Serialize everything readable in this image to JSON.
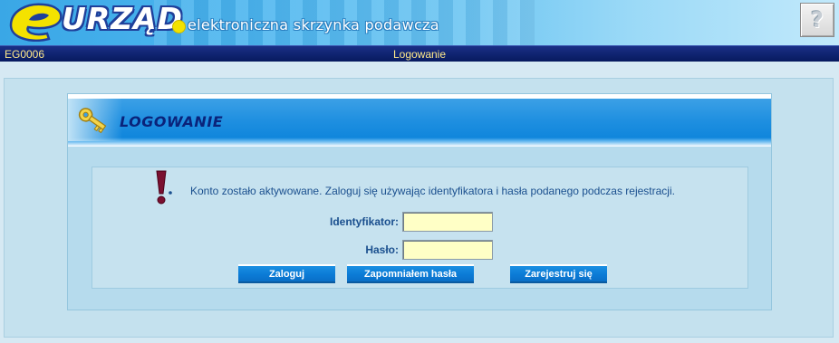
{
  "header": {
    "logo_letter": "e",
    "logo_word": "URZĄD",
    "subtitle": "elektroniczna skrzynka podawcza",
    "help_glyph": "?"
  },
  "statusbar": {
    "code": "EG0006",
    "title": "Logowanie"
  },
  "login": {
    "heading": "LOGOWANIE",
    "message": "Konto zostało aktywowane. Zaloguj się używając identyfikatora i hasła podanego podczas rejestracji.",
    "id_label": "Identyfikator:",
    "id_value": "",
    "password_label": "Hasło:",
    "password_value": "",
    "buttons": {
      "login": "Zaloguj",
      "forgot": "Zapomniałem hasła",
      "register": "Zarejestruj się"
    }
  },
  "icons": [
    "e-logo-icon",
    "help-icon",
    "key-icon",
    "exclamation-icon"
  ],
  "colors": {
    "statusbar_bg": "#071a5e",
    "statusbar_text": "#ffe98a",
    "panel_header_blue": "#1086dc",
    "heading_text": "#0a237a",
    "field_bg": "#ffffc6",
    "button_bg": "#0b7bd6"
  }
}
